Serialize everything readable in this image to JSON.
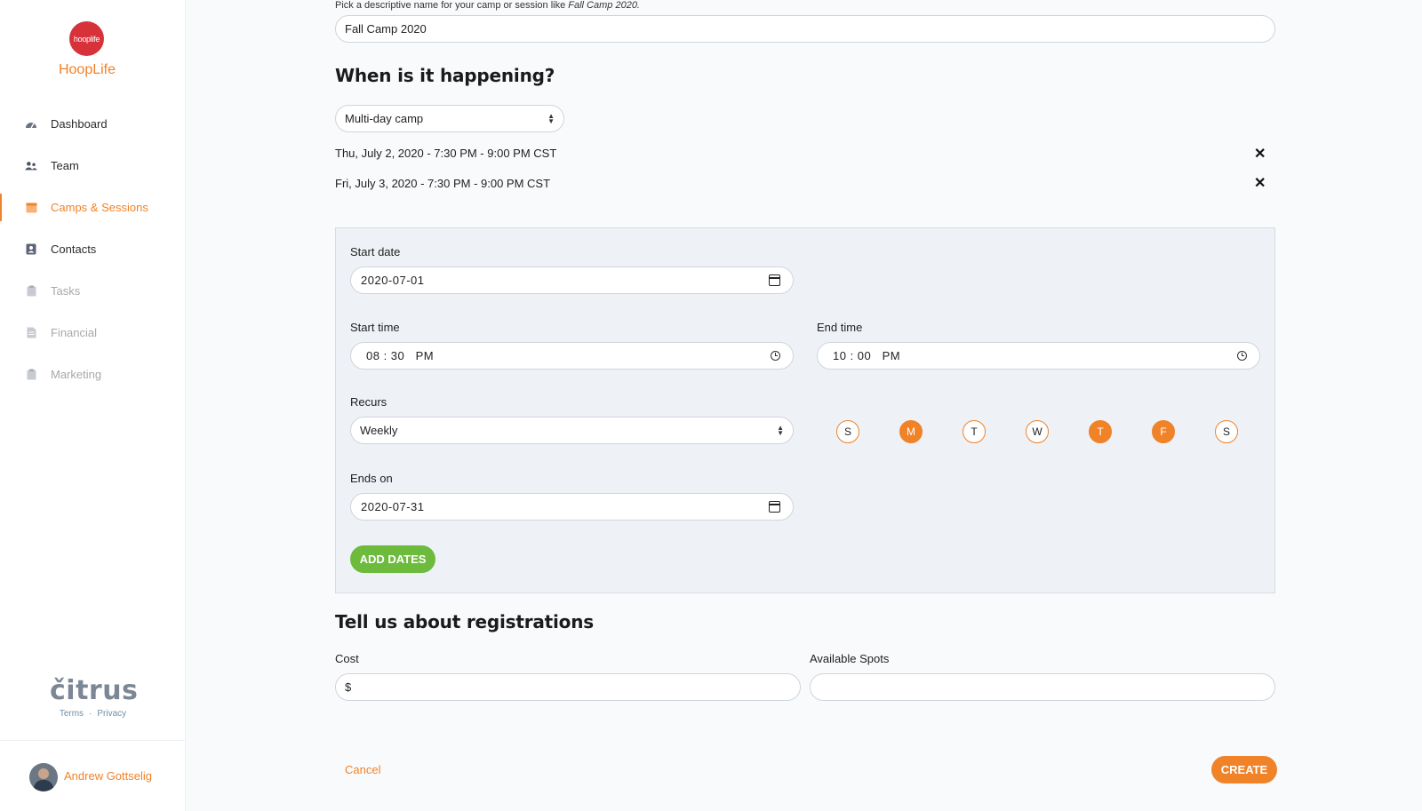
{
  "sidebar": {
    "logo_text": "hooplife",
    "app_name": "HoopLife",
    "items": [
      {
        "label": "Dashboard",
        "icon": "gauge-icon",
        "state": "normal"
      },
      {
        "label": "Team",
        "icon": "users-icon",
        "state": "normal"
      },
      {
        "label": "Camps & Sessions",
        "icon": "calendar-icon",
        "state": "active"
      },
      {
        "label": "Contacts",
        "icon": "address-book-icon",
        "state": "normal"
      },
      {
        "label": "Tasks",
        "icon": "clipboard-icon",
        "state": "disabled"
      },
      {
        "label": "Financial",
        "icon": "document-icon",
        "state": "disabled"
      },
      {
        "label": "Marketing",
        "icon": "clipboard-icon",
        "state": "disabled"
      }
    ],
    "brand": "čitrus",
    "footer_links": [
      "Terms",
      "·",
      "Privacy"
    ],
    "user_name": "Andrew Gottselig"
  },
  "form": {
    "name_hint_prefix": "Pick a descriptive name for your camp or session like ",
    "name_hint_example": "Fall Camp 2020.",
    "name_value": "Fall Camp 2020",
    "when_heading": "When is it happening?",
    "schedule_type": "Multi-day camp",
    "dates": [
      "Thu, July 2, 2020 - 7:30 PM - 9:00 PM CST",
      "Fri, July 3, 2020 - 7:30 PM - 9:00 PM CST"
    ],
    "remove_glyph": "✕",
    "panel": {
      "start_date_label": "Start date",
      "start_date": "2020-07-01",
      "start_time_label": "Start time",
      "start_time": "08 : 30   PM",
      "end_time_label": "End time",
      "end_time": "10 : 00   PM",
      "recurs_label": "Recurs",
      "recurs_value": "Weekly",
      "days": [
        {
          "letter": "S",
          "selected": false
        },
        {
          "letter": "M",
          "selected": true
        },
        {
          "letter": "T",
          "selected": false
        },
        {
          "letter": "W",
          "selected": false
        },
        {
          "letter": "T",
          "selected": true
        },
        {
          "letter": "F",
          "selected": true
        },
        {
          "letter": "S",
          "selected": false
        }
      ],
      "ends_on_label": "Ends on",
      "ends_on": "2020-07-31",
      "add_dates_label": "ADD DATES"
    },
    "registrations_heading": "Tell us about registrations",
    "cost_label": "Cost",
    "cost_prefix": "$",
    "spots_label": "Available Spots",
    "cancel_label": "Cancel",
    "create_label": "CREATE"
  },
  "colors": {
    "accent": "#f08228",
    "success": "#6cbb3c",
    "logo": "#d7323a"
  }
}
